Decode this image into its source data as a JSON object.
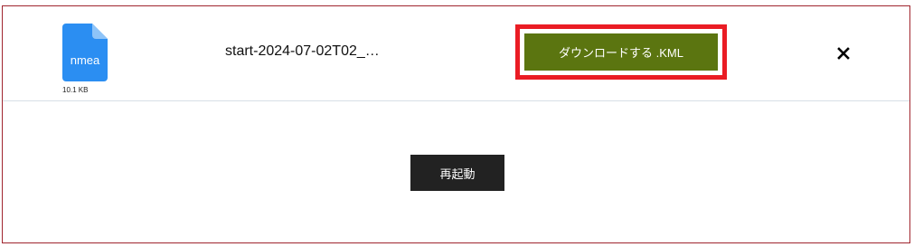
{
  "file": {
    "extension": "nmea",
    "size": "10.1 KB",
    "name": "start-2024-07-02T02_…",
    "icon": "file-icon",
    "icon_color": "#2b8ef2"
  },
  "actions": {
    "download_label": "ダウンロードする .KML",
    "download_color": "#5b7510",
    "highlight_color": "#ea1c24",
    "close_icon": "close-icon",
    "restart_label": "再起動"
  }
}
